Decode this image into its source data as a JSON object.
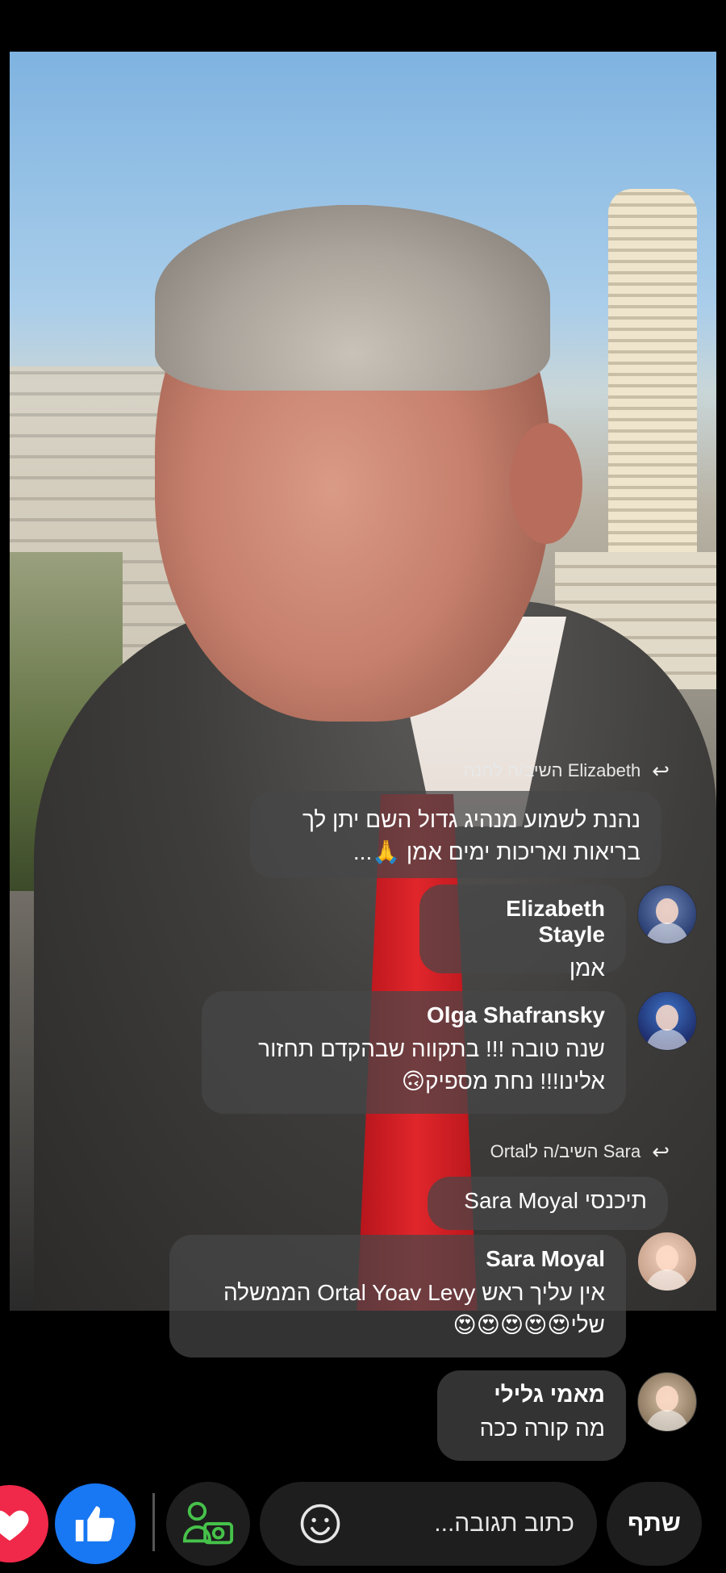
{
  "comments": [
    {
      "reply_text": "השיב/ה לחנה Elizabeth",
      "text": "נהנת לשמוע מנהיג גדול השם יתן לך בריאות ואריכות ימים אמן 🙏..."
    },
    {
      "name": "Elizabeth Stayle",
      "text": "אמן"
    },
    {
      "name": "Olga Shafransky",
      "text": "שנה טובה !!! בתקווה שבהקדם תחזור אלינו!!!  נחת מספיק🙃"
    },
    {
      "reply_text": "Ortalהשיב/ה ל Sara",
      "text": "תיכנסי Sara Moyal"
    },
    {
      "name": "Sara Moyal",
      "text": "אין עליך ראש Ortal Yoav Levy הממשלה שלי😍😍😍😍😍"
    },
    {
      "name": "מאמי גלילי",
      "text": "מה קורה ככה"
    }
  ],
  "bottom_bar": {
    "input_placeholder": "כתוב תגובה...",
    "share_label": "שתף",
    "icons": [
      "love-reaction-icon",
      "like-reaction-icon",
      "camera-person-icon",
      "emoji-icon"
    ]
  },
  "colors": {
    "like": "#1877f2",
    "love": "#f02849",
    "bubble": "rgba(70,70,72,0.72)"
  }
}
